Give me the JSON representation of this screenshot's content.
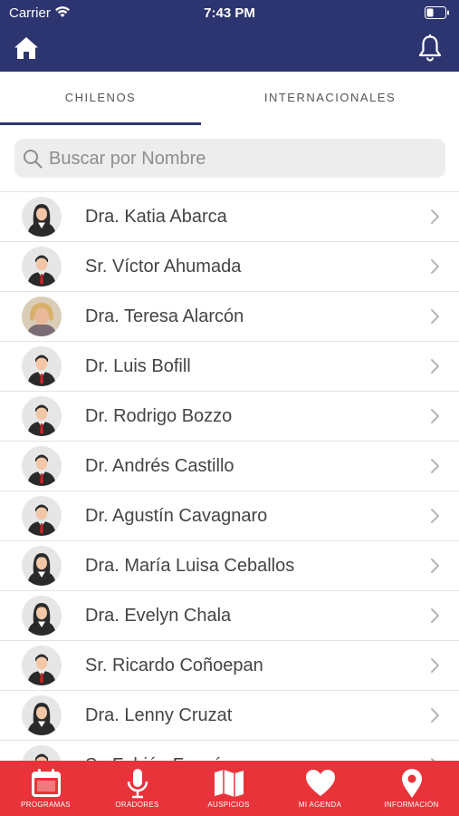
{
  "status_bar": {
    "carrier": "Carrier",
    "time": "7:43 PM"
  },
  "tabs": [
    {
      "label": "CHILENOS",
      "active": true
    },
    {
      "label": "INTERNACIONALES",
      "active": false
    }
  ],
  "search": {
    "placeholder": "Buscar por Nombre",
    "value": ""
  },
  "speakers": [
    {
      "name": "Dra. Katia Abarca",
      "avatar": "female-silhouette"
    },
    {
      "name": "Sr. Víctor Ahumada",
      "avatar": "male-silhouette"
    },
    {
      "name": "Dra. Teresa Alarcón",
      "avatar": "photo"
    },
    {
      "name": "Dr. Luis Bofill",
      "avatar": "male-silhouette"
    },
    {
      "name": "Dr. Rodrigo Bozzo",
      "avatar": "male-silhouette"
    },
    {
      "name": "Dr. Andrés Castillo",
      "avatar": "male-silhouette"
    },
    {
      "name": "Dr. Agustín Cavagnaro",
      "avatar": "male-silhouette"
    },
    {
      "name": "Dra. María Luisa Ceballos",
      "avatar": "female-silhouette"
    },
    {
      "name": "Dra. Evelyn Chala",
      "avatar": "female-silhouette"
    },
    {
      "name": "Sr. Ricardo Coñoepan",
      "avatar": "male-silhouette"
    },
    {
      "name": "Dra. Lenny Cruzat",
      "avatar": "female-silhouette"
    },
    {
      "name": "Sr. Fabián Fermín",
      "avatar": "male-silhouette"
    }
  ],
  "bottom_nav": [
    {
      "label": "PROGRAMAS",
      "icon": "calendar-icon"
    },
    {
      "label": "ORADORES",
      "icon": "microphone-icon"
    },
    {
      "label": "AUSPICIOS",
      "icon": "map-icon"
    },
    {
      "label": "MI AGENDA",
      "icon": "heart-icon"
    },
    {
      "label": "INFORMACIÓN",
      "icon": "location-pin-icon"
    }
  ],
  "colors": {
    "header": "#2d3570",
    "bottom_bar": "#e8333a",
    "tab_indicator": "#2d3570"
  }
}
